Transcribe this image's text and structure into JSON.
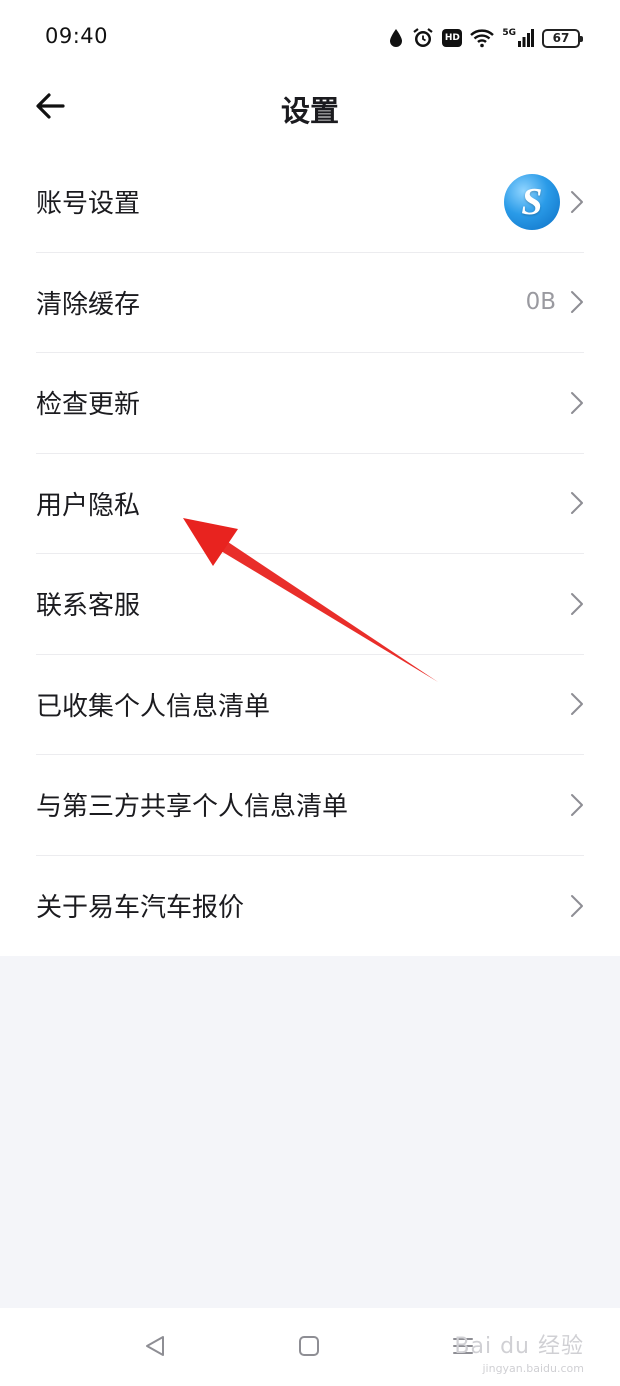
{
  "status_bar": {
    "time": "09:40",
    "icons": [
      "water-drop-icon",
      "alarm-icon",
      "hd-icon",
      "wifi-icon",
      "5g-signal-icon",
      "battery-icon"
    ],
    "hd_label": "HD",
    "network_label": "5G",
    "battery_level": "67"
  },
  "header": {
    "title": "设置",
    "back_icon": "arrow-left-icon"
  },
  "settings": {
    "items": [
      {
        "label": "账号设置",
        "value": "",
        "has_avatar": true
      },
      {
        "label": "清除缓存",
        "value": "0B"
      },
      {
        "label": "检查更新",
        "value": ""
      },
      {
        "label": "用户隐私",
        "value": ""
      },
      {
        "label": "联系客服",
        "value": ""
      },
      {
        "label": "已收集个人信息清单",
        "value": ""
      },
      {
        "label": "与第三方共享个人信息清单",
        "value": ""
      },
      {
        "label": "关于易车汽车报价",
        "value": ""
      }
    ],
    "chevron_icon": "chevron-right-icon",
    "avatar_letter": "S"
  },
  "annotation": {
    "color": "#e8231f",
    "target": "用户隐私"
  },
  "nav_bar": {
    "buttons": [
      "back-triangle-icon",
      "home-square-icon",
      "recents-menu-icon"
    ]
  },
  "watermark": {
    "main": "Bai du 经验",
    "sub": "jingyan.baidu.com"
  },
  "colors": {
    "background": "#f4f5f9",
    "surface": "#ffffff",
    "text_primary": "#1b1b1f",
    "text_secondary": "#9a9aa0",
    "divider": "#ececef"
  }
}
